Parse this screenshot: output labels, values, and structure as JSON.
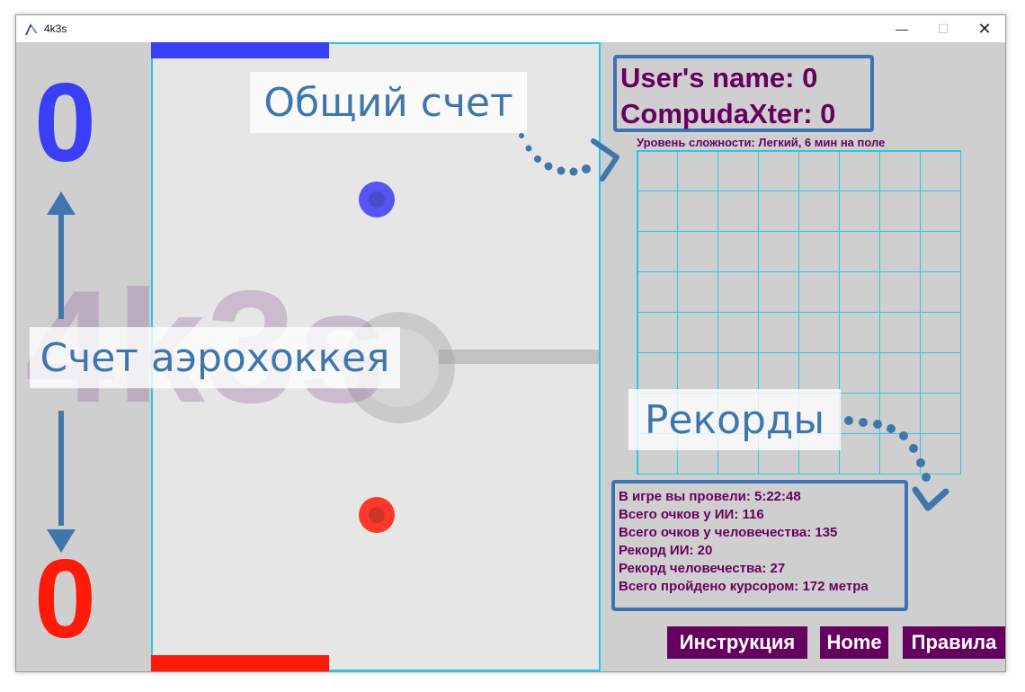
{
  "window": {
    "title": "4k3s",
    "controls": {
      "minimize": "—",
      "maximize": "☐",
      "close": "✕"
    }
  },
  "scores": {
    "top": "0",
    "bottom": "0",
    "top_color": "#3a3ef5",
    "bottom_color": "#ff1a0a"
  },
  "rink": {
    "watermark": "4k3s",
    "border_color": "#29c7e6",
    "top_goal_color": "#3a3ef5",
    "bottom_goal_color": "#ff1a0a"
  },
  "mallets": {
    "player_top_color": "#3a3ef5",
    "player_bottom_color": "#ff1a0a"
  },
  "callouts": {
    "total_score": "Общий счет",
    "air_hockey_score": "Счет аэрохоккея",
    "records": "Рекорды"
  },
  "scoreboard": {
    "user": "User's name: 0",
    "computer": "CompudaXter: 0"
  },
  "difficulty": "Уровень сложности: Легкий, 6 мин на поле",
  "grid": {
    "rows": 8,
    "cols": 8
  },
  "stats": [
    "В игре вы провели: 5:22:48",
    "Всего очков у ИИ: 116",
    "Всего очков у человечества: 135",
    "Рекорд ИИ: 20",
    "Рекорд человечества: 27",
    "Всего пройдено курсором: 172 метра"
  ],
  "buttons": {
    "instructions": "Инструкция",
    "home": "Home",
    "rules": "Правила"
  },
  "colors": {
    "accent_purple": "#66005f",
    "annotation_blue": "#3e76ad",
    "box_border": "#3d73b3"
  }
}
